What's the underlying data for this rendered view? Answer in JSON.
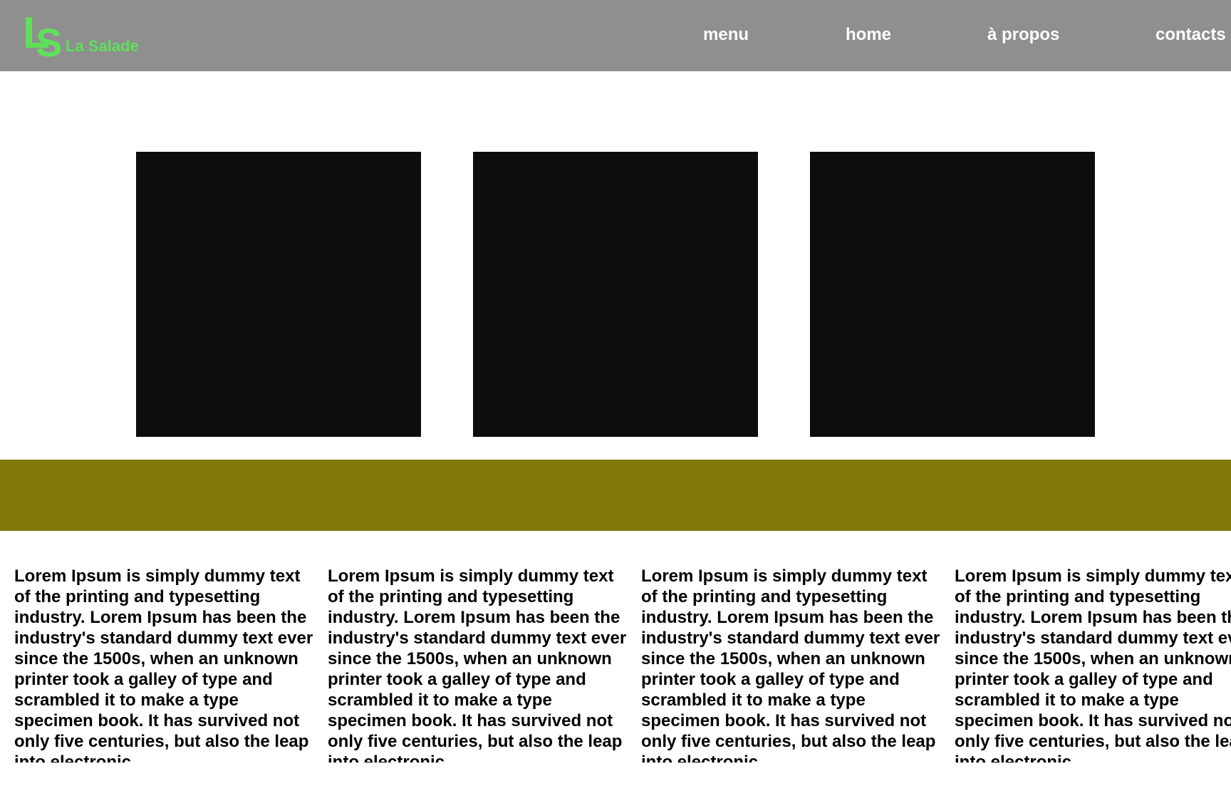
{
  "brand": {
    "mark_l": "L",
    "mark_s": "S",
    "name": "La Salade",
    "color": "#5fe05a"
  },
  "header": {
    "background": "#8f8f8f"
  },
  "nav": {
    "items": [
      {
        "label": "menu"
      },
      {
        "label": "home"
      },
      {
        "label": "à propos"
      },
      {
        "label": "contacts"
      }
    ]
  },
  "gallery": {
    "image_color": "#0d0d0d"
  },
  "banner": {
    "color": "#83780c"
  },
  "columns": [
    {
      "text": "Lorem Ipsum is simply dummy text of the printing and typesetting industry. Lorem Ipsum has been the industry's standard dummy text ever since the 1500s, when an unknown printer took a galley of type and scrambled it to make a type specimen book. It has survived not only five centuries, but also the leap into electronic"
    },
    {
      "text": "Lorem Ipsum is simply dummy text of the printing and typesetting industry. Lorem Ipsum has been the industry's standard dummy text ever since the 1500s, when an unknown printer took a galley of type and scrambled it to make a type specimen book. It has survived not only five centuries, but also the leap into electronic"
    },
    {
      "text": "Lorem Ipsum is simply dummy text of the printing and typesetting industry. Lorem Ipsum has been the industry's standard dummy text ever since the 1500s, when an unknown printer took a galley of type and scrambled it to make a type specimen book. It has survived not only five centuries, but also the leap into electronic"
    },
    {
      "text": "Lorem Ipsum is simply dummy text of the printing and typesetting industry. Lorem Ipsum has been the industry's standard dummy text ever since the 1500s, when an unknown printer took a galley of type and scrambled it to make a type specimen book. It has survived not only five centuries, but also the leap into electronic"
    }
  ]
}
